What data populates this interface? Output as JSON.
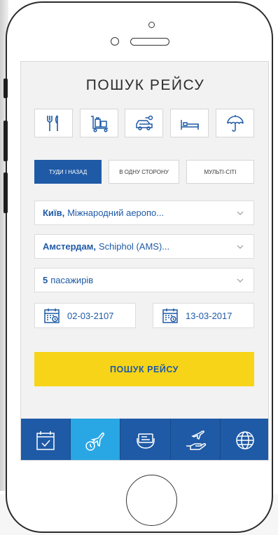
{
  "title": "ПОШУК РЕЙСУ",
  "categories": [
    {
      "icon": "fork-knife-icon"
    },
    {
      "icon": "luggage-cart-icon"
    },
    {
      "icon": "car-rental-icon"
    },
    {
      "icon": "bed-icon"
    },
    {
      "icon": "umbrella-icon"
    }
  ],
  "trip_types": [
    {
      "label": "ТУДИ І НАЗАД",
      "active": true
    },
    {
      "label": "В ОДНУ СТОРОНУ",
      "active": false
    },
    {
      "label": "МУЛЬТІ-СІТІ",
      "active": false
    }
  ],
  "from": {
    "city": "Київ,",
    "airport": "Міжнародний аеропо..."
  },
  "to": {
    "city": "Амстердам,",
    "airport": "Schiphol (AMS)..."
  },
  "passengers": {
    "count": "5",
    "label": "пасажирів"
  },
  "dates": {
    "depart": "02-03-2107",
    "return": "13-03-2017"
  },
  "search_button": "ПОШУК РЕЙСУ",
  "tabs": [
    {
      "icon": "checkbox-calendar-icon",
      "active": false
    },
    {
      "icon": "flight-clock-icon",
      "active": true
    },
    {
      "icon": "ticket-hand-icon",
      "active": false
    },
    {
      "icon": "plane-hand-icon",
      "active": false
    },
    {
      "icon": "globe-icon",
      "active": false
    }
  ],
  "colors": {
    "brand_blue": "#1f5aa6",
    "active_tab": "#29a6e4",
    "cta_yellow": "#f7d417"
  }
}
